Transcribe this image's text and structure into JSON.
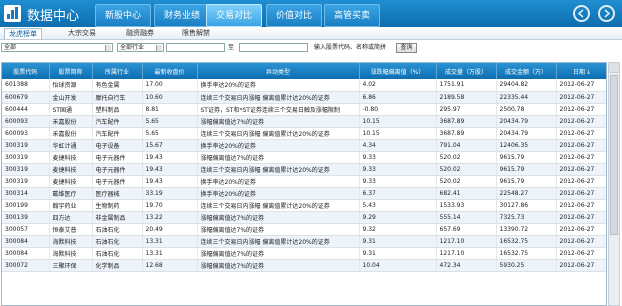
{
  "app": {
    "title": "数据中心"
  },
  "nav": {
    "items": [
      "新股中心",
      "财务业绩",
      "交易对比",
      "价值对比",
      "高管买卖"
    ],
    "active_index": 2
  },
  "subtabs": {
    "items": [
      "龙虎榜单",
      "大宗交易",
      "融资融券",
      "限售解禁"
    ],
    "active_index": 0
  },
  "filters": {
    "market": "全部",
    "industry": "全部行业",
    "range_sep": "至",
    "search_placeholder": "输入股票代码、名称或简拼",
    "query_label": "查询"
  },
  "table": {
    "columns": [
      "股票代码",
      "股票简称",
      "所属行业",
      "最新收盘价",
      "异动类型",
      "涨跌幅偏离值（%）",
      "成交量（万股）",
      "成交金额（万）",
      "日期"
    ],
    "sort_indicator": "↓",
    "rows": [
      [
        "601388",
        "怡球资源",
        "有色金属",
        "17.00",
        "换手率达20%的证券",
        "4.02",
        "1751.91",
        "29404.82",
        "2012-06-27"
      ],
      [
        "600679",
        "金山开发",
        "摩托自行车",
        "10.60",
        "连续三个交易日内涨幅 偏离值累计达20%的证券",
        "6.86",
        "2189.58",
        "22335.44",
        "2012-06-27"
      ],
      [
        "600444",
        "ST国通",
        "塑料制品",
        "8.81",
        "ST证券，ST和*ST证券连续三个交易日触及涨幅限制",
        "-0.80",
        "295.97",
        "2500.78",
        "2012-06-27"
      ],
      [
        "600093",
        "禾嘉股份",
        "汽车配件",
        "5.65",
        "涨幅偏离值达7%的证券",
        "10.15",
        "3687.89",
        "20434.79",
        "2012-06-27"
      ],
      [
        "600093",
        "禾嘉股份",
        "汽车配件",
        "5.65",
        "连续三个交易日内涨幅 偏离值累计达20%的证券",
        "10.15",
        "3687.89",
        "20434.79",
        "2012-06-27"
      ],
      [
        "300319",
        "华虹计通",
        "电子设备",
        "15.67",
        "换手率达20%的证券",
        "4.34",
        "791.04",
        "12406.35",
        "2012-06-27"
      ],
      [
        "300319",
        "麦捷科技",
        "电子元器件",
        "19.43",
        "涨幅偏离值达7%的证券",
        "9.33",
        "520.02",
        "9615.79",
        "2012-06-27"
      ],
      [
        "300319",
        "麦捷科技",
        "电子元器件",
        "19.43",
        "连续三个交易日内涨幅 偏离值累计达20%的证券",
        "9.33",
        "520.02",
        "9615.79",
        "2012-06-27"
      ],
      [
        "300319",
        "麦捷科技",
        "电子元器件",
        "19.43",
        "换手率达20%的证券",
        "9.33",
        "520.02",
        "9615.79",
        "2012-06-27"
      ],
      [
        "300314",
        "戴维医疗",
        "医疗器械",
        "33.19",
        "换手率达20%的证券",
        "6.37",
        "682.41",
        "22548.27",
        "2012-06-27"
      ],
      [
        "300199",
        "翰宇药业",
        "生物制药",
        "19.70",
        "连续三个交易日内涨幅 偏离值累计达20%的证券",
        "5.43",
        "1533.93",
        "30127.86",
        "2012-06-27"
      ],
      [
        "300139",
        "四方达",
        "非金属制品",
        "13.22",
        "涨幅偏离值达7%的证券",
        "9.29",
        "555.14",
        "7325.73",
        "2012-06-27"
      ],
      [
        "300057",
        "恒泰艾普",
        "石油石化",
        "20.49",
        "涨幅偏离值达7%的证券",
        "9.32",
        "657.69",
        "13390.72",
        "2012-06-27"
      ],
      [
        "300084",
        "海默科技",
        "石油石化",
        "13.31",
        "连续三个交易日内涨幅 偏离值累计达20%的证券",
        "9.31",
        "1217.10",
        "16532.75",
        "2012-06-27"
      ],
      [
        "300084",
        "海默科技",
        "石油石化",
        "13.31",
        "涨幅偏离值达7%的证券",
        "9.31",
        "1217.10",
        "16532.75",
        "2012-06-27"
      ],
      [
        "300072",
        "三聚环保",
        "化学制品",
        "12.68",
        "涨幅偏离值达7%的证券",
        "10.04",
        "472.34",
        "5930.25",
        "2012-06-27"
      ]
    ]
  },
  "colors": {
    "header": "#0d6eb0",
    "nav_active": "#7fd0fb",
    "row_alt": "#eef4f9"
  }
}
